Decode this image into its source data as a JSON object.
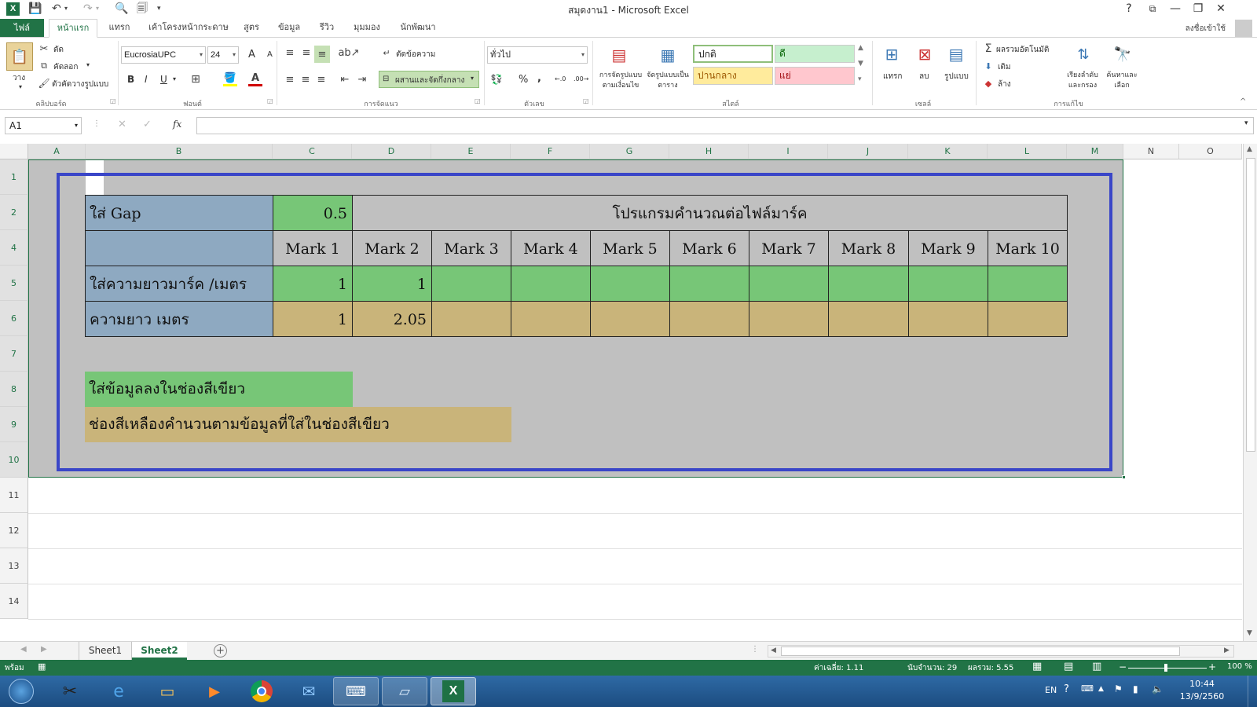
{
  "window": {
    "title": "สมุดงาน1 - Microsoft Excel",
    "help": "?",
    "minimize": "—",
    "restore": "❐",
    "close": "✕"
  },
  "quick_access": {
    "save": "💾",
    "undo": "↶",
    "redo": "↷",
    "print_preview": "🗐",
    "customize": "▾"
  },
  "tabs": {
    "file": "ไฟล์",
    "items": [
      "หน้าแรก",
      "แทรก",
      "เค้าโครงหน้ากระดาษ",
      "สูตร",
      "ข้อมูล",
      "รีวิว",
      "มุมมอง",
      "นักพัฒนา"
    ],
    "active": "หน้าแรก",
    "sign_in": "ลงชื่อเข้าใช้"
  },
  "ribbon": {
    "clipboard": {
      "paste": "วาง",
      "cut": "ตัด",
      "copy": "คัดลอก",
      "format_painter": "ตัวคัดวางรูปแบบ",
      "label": "คลิปบอร์ด"
    },
    "font": {
      "name": "EucrosiaUPC",
      "size": "24",
      "grow": "A",
      "shrink": "A",
      "bold": "B",
      "italic": "I",
      "underline": "U",
      "label": "ฟอนต์"
    },
    "alignment": {
      "wrap": "ตัดข้อความ",
      "merge": "ผสานและจัดกึ่งกลาง",
      "label": "การจัดแนว"
    },
    "number": {
      "format": "ทั่วไป",
      "percent": "%",
      "comma": ",",
      "label": "ตัวเลข"
    },
    "styles": {
      "conditional": "การจัดรูปแบบตามเงื่อนไข",
      "as_table": "จัดรูปแบบเป็นตาราง",
      "normal": "ปกติ",
      "good": "ดี",
      "neutral": "ปานกลาง",
      "bad": "แย่",
      "label": "สไตล์"
    },
    "cells": {
      "insert": "แทรก",
      "delete": "ลบ",
      "format": "รูปแบบ",
      "label": "เซลล์"
    },
    "editing": {
      "autosum": "ผลรวมอัตโนมัติ",
      "fill": "เติม",
      "clear": "ล้าง",
      "sort": "เรียงลำดับและกรอง",
      "find": "ค้นหาและเลือก",
      "label": "การแก้ไข"
    }
  },
  "formula_bar": {
    "name_box": "A1",
    "cancel": "✕",
    "enter": "✓",
    "fx": "fx",
    "formula": ""
  },
  "columns": [
    "A",
    "B",
    "C",
    "D",
    "E",
    "F",
    "G",
    "H",
    "I",
    "J",
    "K",
    "L",
    "M",
    "N",
    "O"
  ],
  "rows": [
    "1",
    "2",
    "4",
    "5",
    "6",
    "7",
    "8",
    "9",
    "10",
    "11",
    "12",
    "13",
    "14"
  ],
  "sheet": {
    "gap_label": "ใส่ Gap",
    "gap_value": "0.5",
    "title": "โปรแกรมคำนวณต่อไฟล์มาร์ค",
    "marks": [
      "Mark 1",
      "Mark 2",
      "Mark 3",
      "Mark 4",
      "Mark 5",
      "Mark 6",
      "Mark 7",
      "Mark 8",
      "Mark 9",
      "Mark 10"
    ],
    "input_label": "ใส่ความยาวมาร์ค /เมตร",
    "input_values": [
      "1",
      "1",
      "",
      "",
      "",
      "",
      "",
      "",
      "",
      ""
    ],
    "length_label": "ความยาว เมตร",
    "length_values": [
      "1",
      "2.05",
      "",
      "",
      "",
      "",
      "",
      "",
      "",
      ""
    ],
    "note_green": "ใส่ข้อมูลลงในช่องสีเขียว",
    "note_yellow": "ช่องสีเหลืองคำนวนตามข้อมูลที่ใส่ในช่องสีเขียว"
  },
  "sheet_tabs": [
    "Sheet1",
    "Sheet2"
  ],
  "active_sheet": "Sheet2",
  "status": {
    "ready": "พร้อม",
    "average": "ค่าเฉลี่ย: 1.11",
    "count": "นับจำนวน: 29",
    "sum": "ผลรวม: 5.55",
    "zoom": "100 %"
  },
  "taskbar": {
    "lang": "EN",
    "time": "10:44",
    "date": "13/9/2560"
  },
  "colors": {
    "excel_green": "#217346",
    "input_green": "#77c677",
    "calc_tan": "#c9b47a",
    "label_blue": "#8ea9c1",
    "frame_blue": "#3a46c8"
  }
}
